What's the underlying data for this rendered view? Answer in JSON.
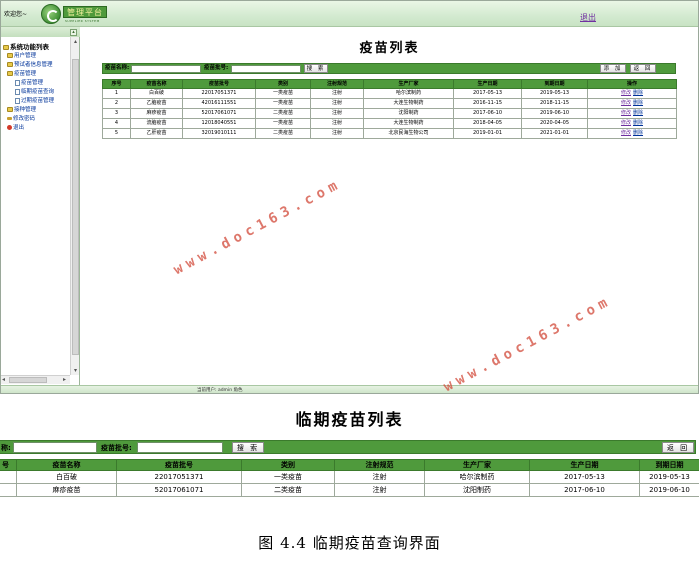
{
  "screen1": {
    "header": {
      "welcome": "欢迎您~",
      "logo_text": "管理平台",
      "logo_sub": "SUPPLIER SYSTEM",
      "logout": "退出"
    },
    "sidebar": {
      "root": "系统功能列表",
      "items": [
        {
          "label": "用户管理",
          "level": 1,
          "icon": "folder-icon"
        },
        {
          "label": "预试者信息管理",
          "level": 1,
          "icon": "folder-icon"
        },
        {
          "label": "疫苗管理",
          "level": 1,
          "icon": "folder-icon"
        },
        {
          "label": "疫苗管理",
          "level": 2,
          "icon": "page-icon"
        },
        {
          "label": "临期疫苗查询",
          "level": 2,
          "icon": "page-icon"
        },
        {
          "label": "过期疫苗管理",
          "level": 2,
          "icon": "page-icon"
        },
        {
          "label": "接种管理",
          "level": 1,
          "icon": "folder-icon"
        },
        {
          "label": "修改密码",
          "level": 1,
          "icon": "key-icon"
        },
        {
          "label": "退出",
          "level": 1,
          "icon": "power-icon"
        }
      ]
    },
    "main": {
      "title": "疫苗列表",
      "search": {
        "name_label": "疫苗名称:",
        "batch_label": "疫苗批号:",
        "search_button": "搜 索",
        "add_button": "添 加",
        "back_button": "返 回"
      },
      "table": {
        "headers": [
          "序号",
          "疫苗名称",
          "疫苗批号",
          "类别",
          "注射规范",
          "生产厂家",
          "生产日期",
          "到期日期",
          "操作"
        ],
        "rows": [
          [
            "1",
            "白百破",
            "22017051371",
            "一类疫苗",
            "注射",
            "哈尔滨制药",
            "2017-05-13",
            "2019-05-13"
          ],
          [
            "2",
            "乙脑疫苗",
            "42016111551",
            "一类疫苗",
            "注射",
            "大连生物制药",
            "2016-11-15",
            "2018-11-15"
          ],
          [
            "3",
            "麻疹疫苗",
            "52017061071",
            "二类疫苗",
            "注射",
            "沈阳制药",
            "2017-06-10",
            "2019-06-10"
          ],
          [
            "4",
            "流脑疫苗",
            "12018040551",
            "一类疫苗",
            "注射",
            "大连生物制药",
            "2018-04-05",
            "2020-04-05"
          ],
          [
            "5",
            "乙肝疫苗",
            "32019010111",
            "二类疫苗",
            "注射",
            "北京民海生物公司",
            "2019-01-01",
            "2021-01-01"
          ]
        ],
        "edit_label": "修改",
        "delete_label": "删除"
      }
    },
    "status": "当前用户: admin 角色",
    "watermark": "www.doc163.com"
  },
  "screen2": {
    "title": "临期疫苗列表",
    "search": {
      "name_label": "称:",
      "batch_label": "疫苗批号:",
      "search_button": "搜 索",
      "back_button": "返 回"
    },
    "table": {
      "headers": [
        "号",
        "疫苗名称",
        "疫苗批号",
        "类别",
        "注射规范",
        "生产厂家",
        "生产日期",
        "到期日期"
      ],
      "rows": [
        [
          "",
          "白百破",
          "22017051371",
          "一类疫苗",
          "注射",
          "哈尔滨制药",
          "2017-05-13",
          "2019-05-13"
        ],
        [
          "",
          "麻疹疫苗",
          "52017061071",
          "二类疫苗",
          "注射",
          "沈阳制药",
          "2017-06-10",
          "2019-06-10"
        ]
      ]
    }
  },
  "caption": "图 4.4  临期疫苗查询界面"
}
